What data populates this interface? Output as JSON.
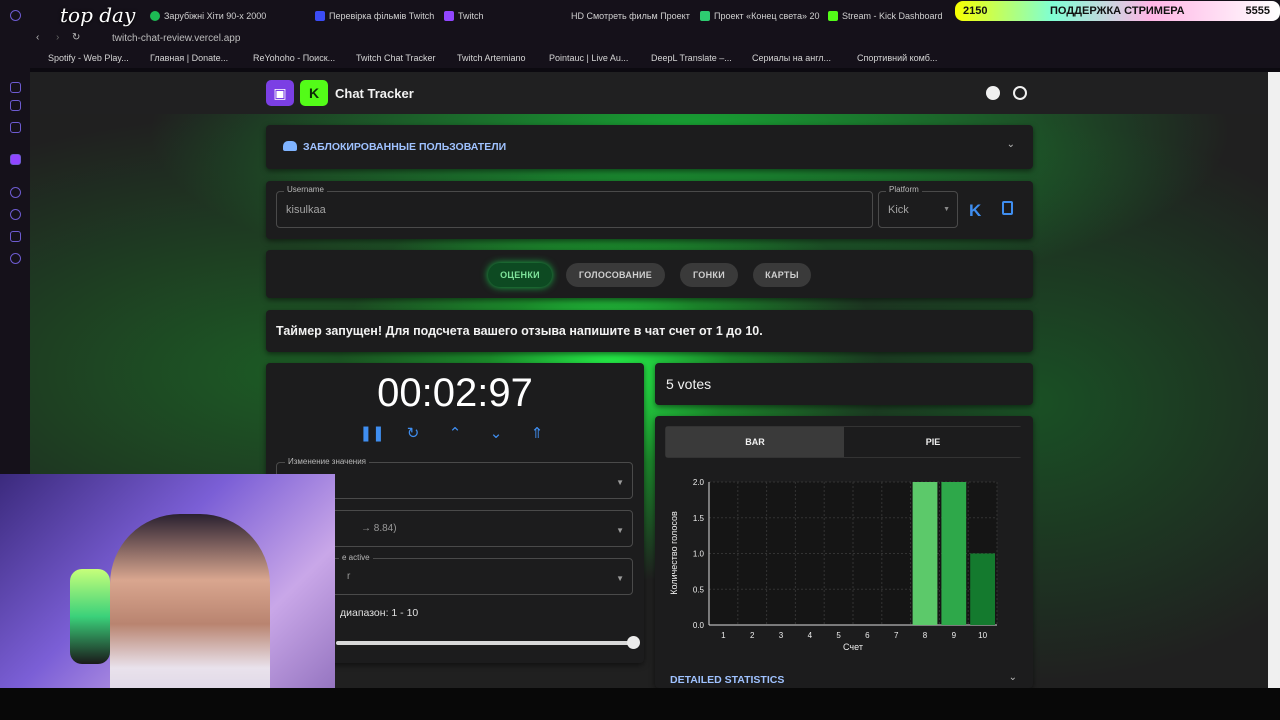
{
  "browser": {
    "tabs": [
      {
        "label": "top day",
        "color": "#ffffff"
      },
      {
        "label": "Зарубіжні Хіти 90-х 2000",
        "color": "#1db954"
      },
      {
        "label": "Перевірка фільмів Twitch",
        "color": "#3b4cf5"
      },
      {
        "label": "Twitch",
        "color": "#9146ff"
      },
      {
        "label": "HD Смотреть фильм Проект",
        "color": "#333333"
      },
      {
        "label": "Проект «Конец света» 20",
        "color": "#2ecc71"
      },
      {
        "label": "Stream - Kick Dashboard",
        "color": "#53fc18"
      }
    ],
    "promo": {
      "left": "2150",
      "middle": "ПОДДЕРЖКА СТРИМЕРА",
      "right": "5555"
    },
    "url": "twitch-chat-review.vercel.app",
    "bookmarks": [
      "Spotify - Web Play...",
      "Главная | Donate...",
      "ReYohoho - Поиск...",
      "Twitch Chat Tracker",
      "Twitch Artemiano",
      "Pointauc | Live Au...",
      "DeepL Translate –...",
      "Сериалы на англ...",
      "Спортивний комб..."
    ]
  },
  "app": {
    "title": "Chat Tracker",
    "blocked_users": "ЗАБЛОКИРОВАННЫЕ ПОЛЬЗОВАТЕЛИ",
    "username_label": "Username",
    "username_value": "kisulkaa",
    "platform_label": "Platform",
    "platform_value": "Kick",
    "chips": [
      "ОЦЕНКИ",
      "ГОЛОСОВАНИЕ",
      "ГОНКИ",
      "КАРТЫ"
    ],
    "message": "Таймер запущен! Для подсчета вашего отзыва напишите в чат счет от 1 до 10.",
    "timer": "00:02:97",
    "change_value_label": "Изменение значения",
    "dropdown2_value": "→ 8.84)",
    "dropdown3_label": "e active",
    "dropdown3_value": "r",
    "range_text": "диапазон: 1 - 10",
    "votes": "5 votes",
    "chart_tabs": [
      "BAR",
      "PIE"
    ],
    "detailed_stats": "DETAILED STATISTICS"
  },
  "webcam": {
    "title": "top day"
  },
  "colors": {
    "accent_green": "#1fd152",
    "blue": "#3f8ef0",
    "card": "#1c1c1d"
  },
  "chart_data": {
    "type": "bar",
    "categories": [
      "1",
      "2",
      "3",
      "4",
      "5",
      "6",
      "7",
      "8",
      "9",
      "10"
    ],
    "values": [
      0,
      0,
      0,
      0,
      0,
      0,
      0,
      2,
      2,
      1
    ],
    "bar_colors": {
      "8": "#5cc96a",
      "9": "#2ea84a",
      "10": "#147a2e"
    },
    "xlabel": "Счет",
    "ylabel": "Количество голосов",
    "yticks": [
      "0.0",
      "0.5",
      "1.0",
      "1.5",
      "2.0"
    ],
    "ylim": [
      0,
      2
    ],
    "grid": true
  }
}
